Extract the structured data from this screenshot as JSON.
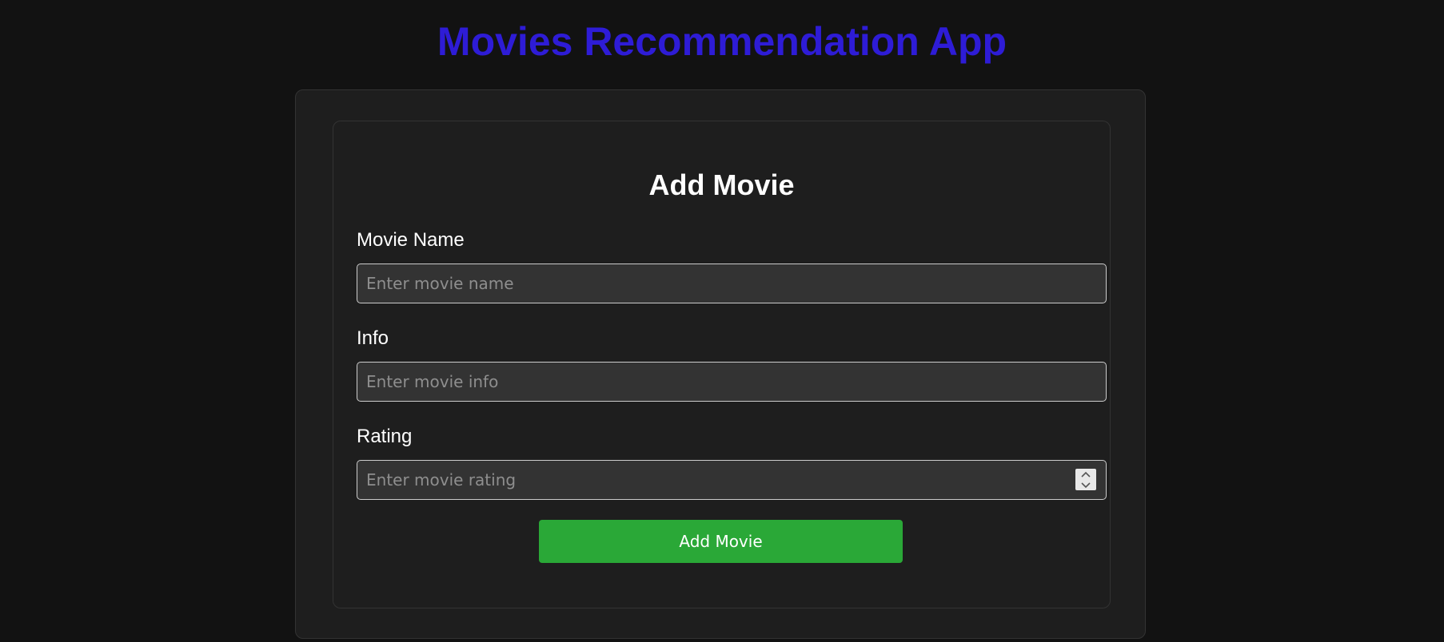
{
  "app": {
    "title": "Movies Recommendation App",
    "title_color": "#2e1cd6"
  },
  "form": {
    "heading": "Add Movie",
    "fields": [
      {
        "label": "Movie Name",
        "placeholder": "Enter movie name",
        "value": ""
      },
      {
        "label": "Info",
        "placeholder": "Enter movie info",
        "value": ""
      },
      {
        "label": "Rating",
        "placeholder": "Enter movie rating",
        "value": "",
        "type": "number"
      }
    ],
    "submit_label": "Add Movie",
    "submit_color": "#2aa837"
  },
  "icons": {
    "spinner_up": "chevron-up-icon",
    "spinner_down": "chevron-down-icon"
  }
}
